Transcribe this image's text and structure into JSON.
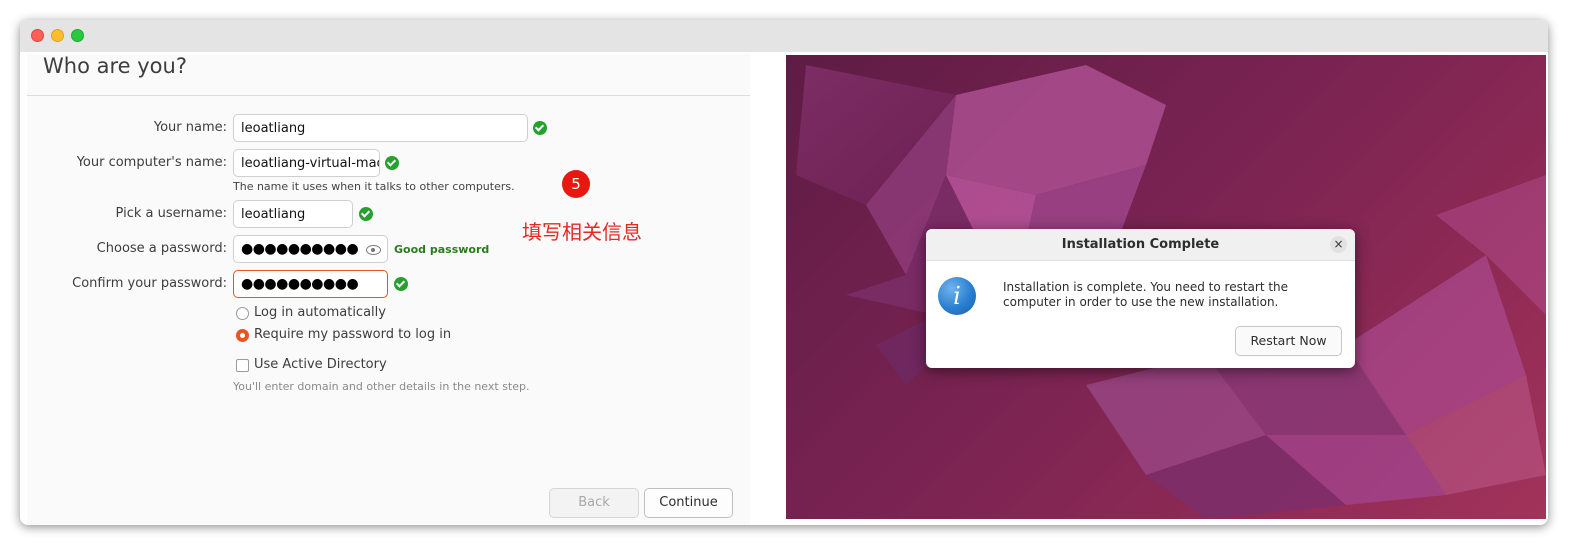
{
  "installer": {
    "title": "Who are you?",
    "fields": {
      "name": {
        "label": "Your name:",
        "value": "leoatliang"
      },
      "computer": {
        "label": "Your computer's name:",
        "value": "leoatliang-virtual-mach",
        "hint": "The name it uses when it talks to other computers."
      },
      "username": {
        "label": "Pick a username:",
        "value": "leoatliang"
      },
      "password": {
        "label": "Choose a password:",
        "value": "●●●●●●●●●●",
        "strength": "Good password"
      },
      "confirm": {
        "label": "Confirm your password:",
        "value": "●●●●●●●●●●"
      }
    },
    "options": {
      "auto_login": "Log in automatically",
      "require_password": "Require my password to log in",
      "active_directory": "Use Active Directory",
      "ad_hint": "You'll enter domain and other details in the next step."
    },
    "buttons": {
      "back": "Back",
      "continue": "Continue"
    }
  },
  "annotation": {
    "step": "5",
    "note": "填写相关信息"
  },
  "dialog": {
    "title": "Installation Complete",
    "close": "×",
    "icon_glyph": "i",
    "message": "Installation is complete. You need to restart the computer in order to use the new installation.",
    "button": "Restart Now"
  },
  "icons": [
    "close-dot",
    "minimize-dot",
    "maximize-dot",
    "check-icon",
    "eye-icon",
    "info-icon",
    "close-icon"
  ],
  "colors": {
    "accent": "#e95420",
    "success": "#26a12f",
    "annotation": "#e8170f",
    "desktop": "#7a2352"
  }
}
